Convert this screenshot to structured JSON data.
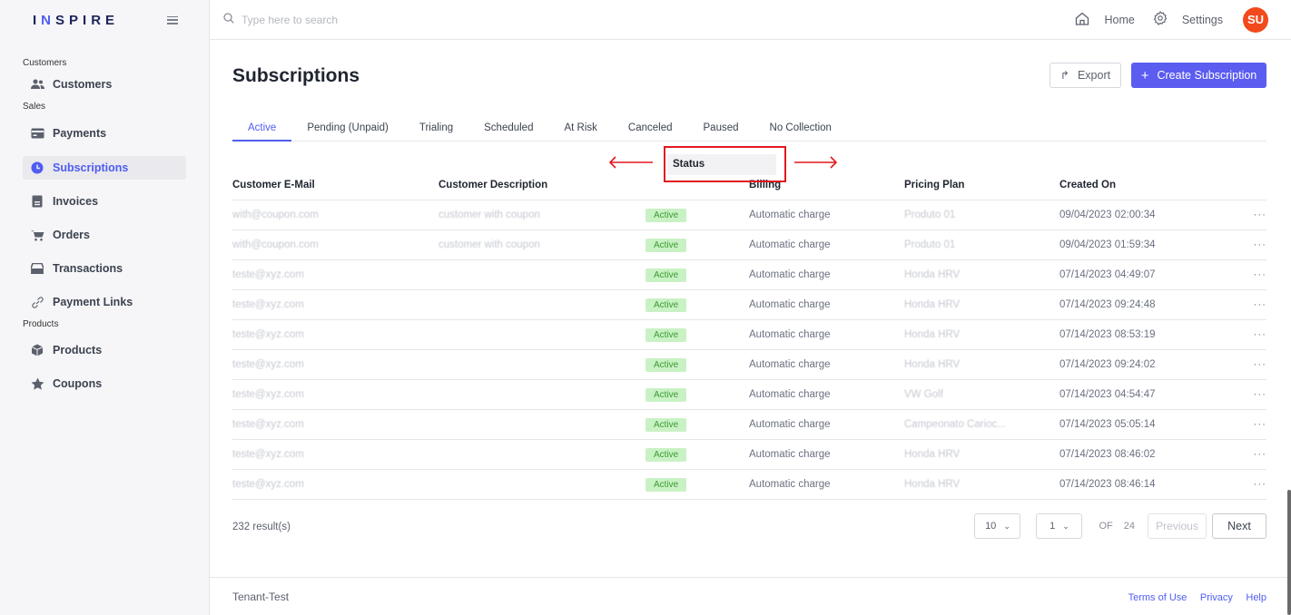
{
  "sidebar": {
    "logo_part1": "I",
    "logo_accent": "N",
    "logo_part2": "SPIRE",
    "sections": {
      "customers": "Customers",
      "sales": "Sales",
      "products": "Products"
    },
    "items": {
      "customers": "Customers",
      "payments": "Payments",
      "subscriptions": "Subscriptions",
      "invoices": "Invoices",
      "orders": "Orders",
      "transactions": "Transactions",
      "payment_links": "Payment Links",
      "products": "Products",
      "coupons": "Coupons"
    }
  },
  "header": {
    "search_placeholder": "Type here to search",
    "home": "Home",
    "settings": "Settings",
    "avatar": "SU"
  },
  "page": {
    "title": "Subscriptions",
    "export_label": "Export",
    "create_label": "Create Subscription"
  },
  "tabs": [
    "Active",
    "Pending (Unpaid)",
    "Trialing",
    "Scheduled",
    "At Risk",
    "Canceled",
    "Paused",
    "No Collection"
  ],
  "annotation": {
    "status_label": "Status"
  },
  "table": {
    "columns": {
      "email": "Customer E-Mail",
      "description": "Customer Description",
      "status": "",
      "billing": "Billing",
      "plan": "Pricing Plan",
      "created": "Created On"
    },
    "rows": [
      {
        "email": "with@coupon.com",
        "description": "customer with coupon",
        "status": "Active",
        "billing": "Automatic charge",
        "plan": "Produto 01",
        "created": "09/04/2023 02:00:34",
        "more": "···"
      },
      {
        "email": "with@coupon.com",
        "description": "customer with coupon",
        "status": "Active",
        "billing": "Automatic charge",
        "plan": "Produto 01",
        "created": "09/04/2023 01:59:34",
        "more": "···"
      },
      {
        "email": "teste@xyz.com",
        "description": "",
        "status": "Active",
        "billing": "Automatic charge",
        "plan": "Honda HRV",
        "created": "07/14/2023 04:49:07",
        "more": "···"
      },
      {
        "email": "teste@xyz.com",
        "description": "",
        "status": "Active",
        "billing": "Automatic charge",
        "plan": "Honda HRV",
        "created": "07/14/2023 09:24:48",
        "more": "···"
      },
      {
        "email": "teste@xyz.com",
        "description": "",
        "status": "Active",
        "billing": "Automatic charge",
        "plan": "Honda HRV",
        "created": "07/14/2023 08:53:19",
        "more": "···"
      },
      {
        "email": "teste@xyz.com",
        "description": "",
        "status": "Active",
        "billing": "Automatic charge",
        "plan": "Honda HRV",
        "created": "07/14/2023 09:24:02",
        "more": "···"
      },
      {
        "email": "teste@xyz.com",
        "description": "",
        "status": "Active",
        "billing": "Automatic charge",
        "plan": "VW Golf",
        "created": "07/14/2023 04:54:47",
        "more": "···"
      },
      {
        "email": "teste@xyz.com",
        "description": "",
        "status": "Active",
        "billing": "Automatic charge",
        "plan": "Campeonato Carioc...",
        "created": "07/14/2023 05:05:14",
        "more": "···"
      },
      {
        "email": "teste@xyz.com",
        "description": "",
        "status": "Active",
        "billing": "Automatic charge",
        "plan": "Honda HRV",
        "created": "07/14/2023 08:46:02",
        "more": "···"
      },
      {
        "email": "teste@xyz.com",
        "description": "",
        "status": "Active",
        "billing": "Automatic charge",
        "plan": "Honda HRV",
        "created": "07/14/2023 08:46:14",
        "more": "···"
      }
    ]
  },
  "pagination": {
    "results": "232 result(s)",
    "page_size": "10",
    "current_page": "1",
    "of_label": "OF",
    "total_pages": "24",
    "previous": "Previous",
    "next": "Next"
  },
  "footer": {
    "tenant": "Tenant-Test",
    "terms": "Terms of Use",
    "privacy": "Privacy",
    "help": "Help"
  },
  "colors": {
    "accent": "#5b5cf0",
    "avatar": "#f24a1d",
    "annotation": "#e0191f",
    "badge_bg": "#c9f2c4"
  }
}
